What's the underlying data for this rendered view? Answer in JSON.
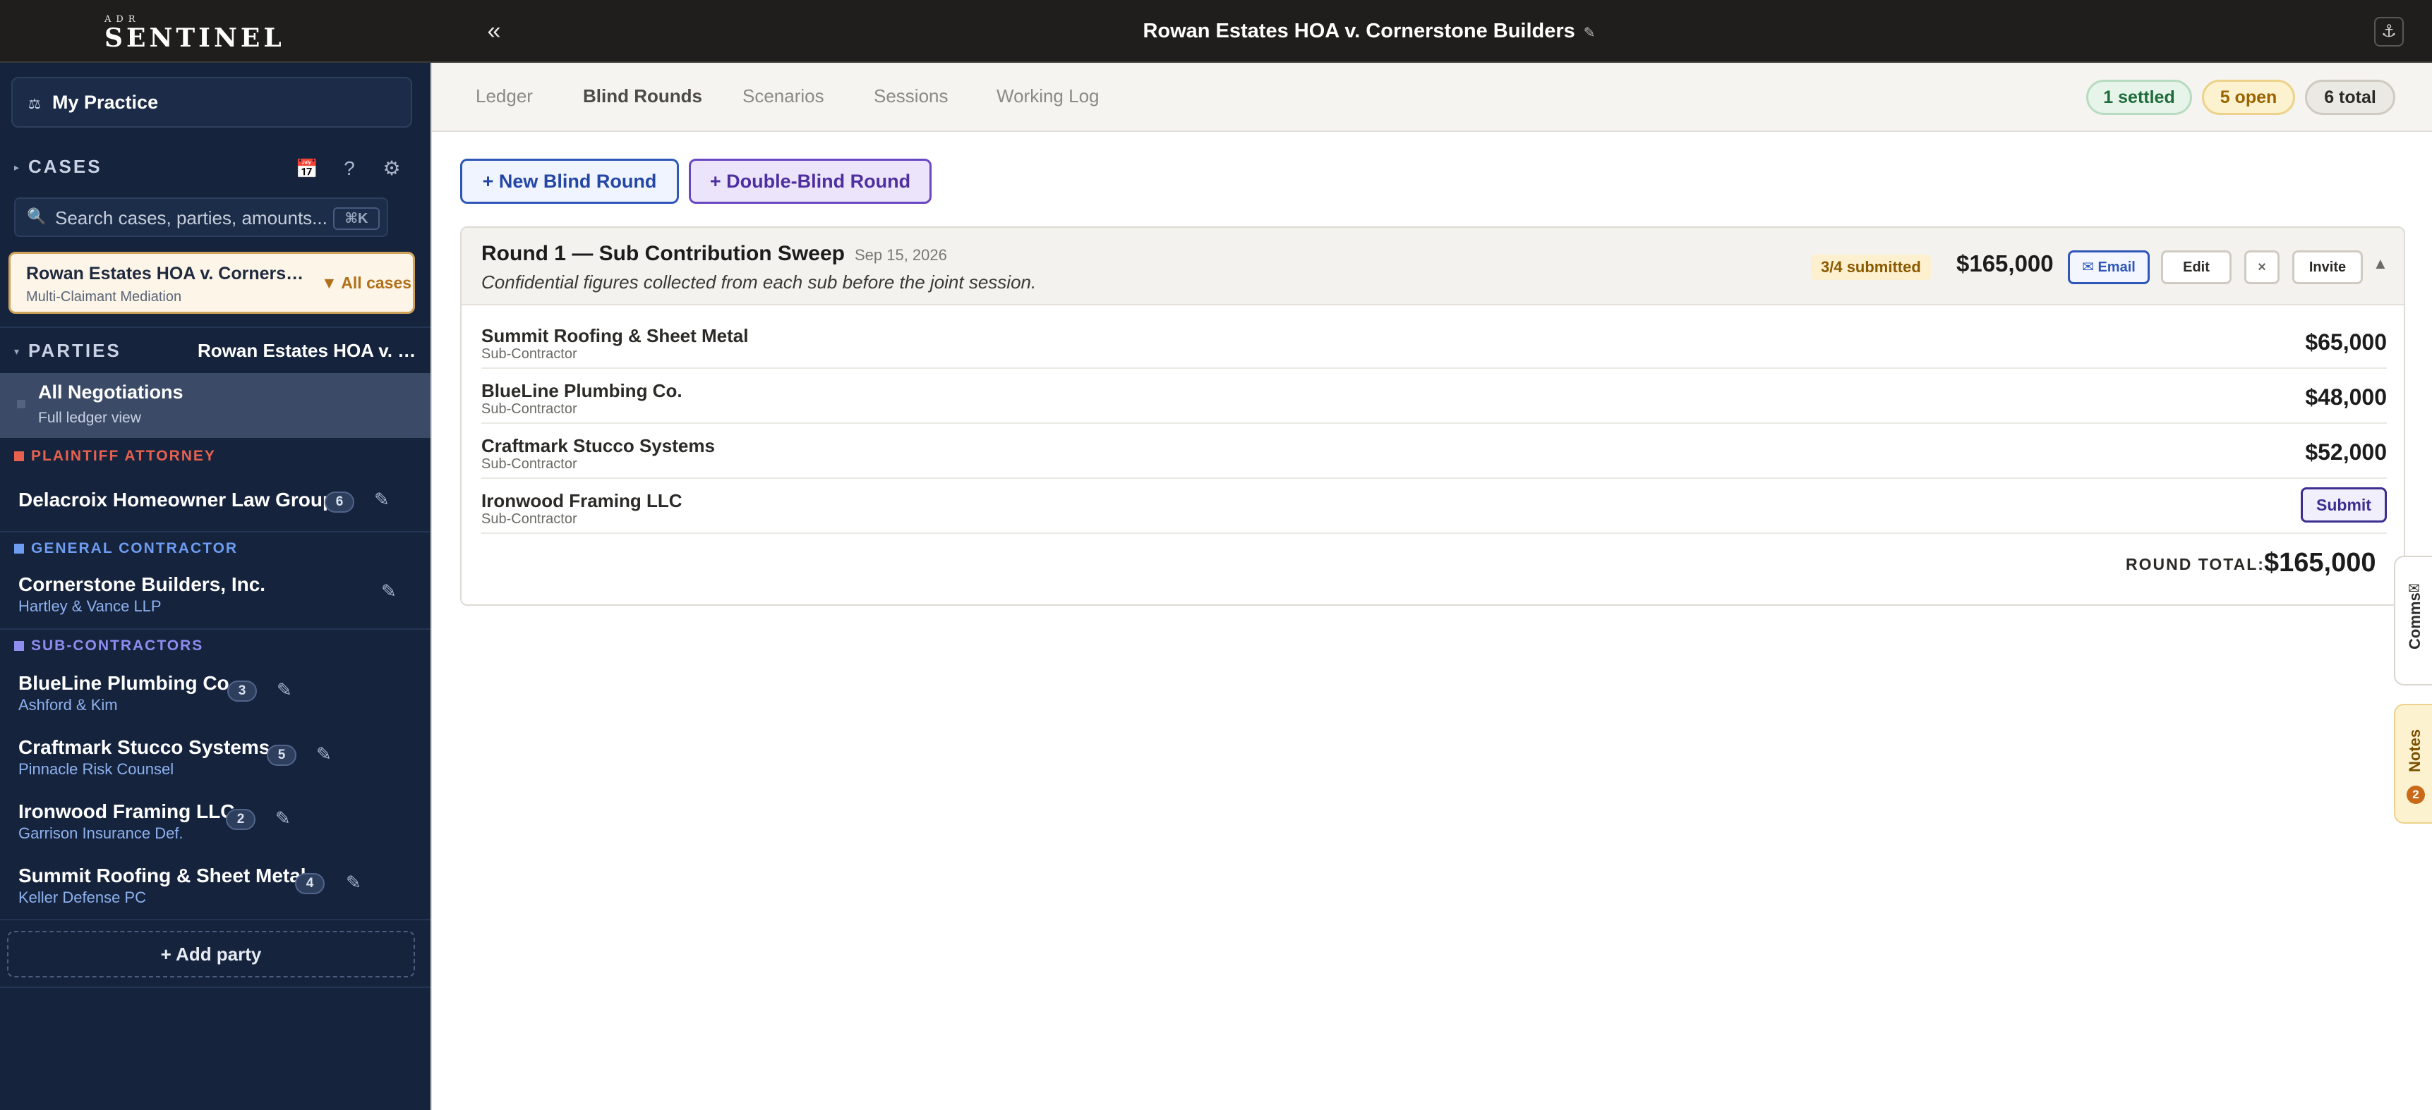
{
  "app": {
    "logo_sup": "ADR",
    "logo_main": "SENTINEL",
    "collapse_glyph": "«",
    "case_title": "Rowan Estates HOA v. Cornerstone Builders",
    "edit_glyph": "✎",
    "anchor_glyph": "⚓"
  },
  "sidebar": {
    "my_practice": "My Practice",
    "my_practice_icon": "⚖",
    "cases_label": "CASES",
    "calendar_icon": "📅",
    "help_icon": "?",
    "settings_icon": "⚙",
    "search_icon": "🔍",
    "search_placeholder": "Search cases, parties, amounts...",
    "search_shortcut": "⌘K",
    "active_case": {
      "name": "Rowan Estates HOA v. Cornerstone Builders",
      "type": "Multi-Claimant Mediation",
      "all_cases": "▼ All cases"
    },
    "parties_label": "PARTIES",
    "parties_case": "Rowan Estates HOA v. Cornerstone Builders",
    "all_negotiations": {
      "title": "All Negotiations",
      "sub": "Full ledger view"
    },
    "groups": {
      "plaintiff": {
        "label": "PLAINTIFF ATTORNEY",
        "color": "#e8614f"
      },
      "gc": {
        "label": "GENERAL CONTRACTOR",
        "color": "#6d9cf0"
      },
      "subs": {
        "label": "SUB-CONTRACTORS",
        "color": "#8f8cf0"
      }
    },
    "parties": [
      {
        "name": "Delacroix Homeowner Law Group",
        "counsel": "",
        "count": "6"
      },
      {
        "name": "Cornerstone Builders, Inc.",
        "counsel": "Hartley & Vance LLP",
        "count": ""
      },
      {
        "name": "BlueLine Plumbing Co.",
        "counsel": "Ashford & Kim",
        "count": "3"
      },
      {
        "name": "Craftmark Stucco Systems",
        "counsel": "Pinnacle Risk Counsel",
        "count": "5"
      },
      {
        "name": "Ironwood Framing LLC",
        "counsel": "Garrison Insurance Def.",
        "count": "2"
      },
      {
        "name": "Summit Roofing & Sheet Metal",
        "counsel": "Keller Defense PC",
        "count": "4"
      }
    ],
    "add_party": "+ Add party"
  },
  "tabs": [
    {
      "label": "Ledger"
    },
    {
      "label": "Blind Rounds",
      "active": true
    },
    {
      "label": "Scenarios"
    },
    {
      "label": "Sessions"
    },
    {
      "label": "Working Log"
    }
  ],
  "status_pills": {
    "settled": "1 settled",
    "open": "5 open",
    "total": "6 total"
  },
  "actions": {
    "new_blind": "+ New Blind Round",
    "double_blind": "+ Double-Blind Round"
  },
  "round": {
    "title": "Round 1 — Sub Contribution Sweep",
    "date": "Sep 15, 2026",
    "description": "Confidential figures collected from each sub before the joint session.",
    "submitted": "3/4 submitted",
    "amount": "$165,000",
    "email": "✉ Email",
    "edit": "Edit",
    "close": "×",
    "invite": "Invite",
    "collapse": "▲",
    "rows": [
      {
        "name": "Summit Roofing & Sheet Metal",
        "role": "Sub-Contractor",
        "amount": "$65,000"
      },
      {
        "name": "BlueLine Plumbing Co.",
        "role": "Sub-Contractor",
        "amount": "$48,000"
      },
      {
        "name": "Craftmark Stucco Systems",
        "role": "Sub-Contractor",
        "amount": "$52,000"
      },
      {
        "name": "Ironwood Framing LLC",
        "role": "Sub-Contractor",
        "amount": ""
      }
    ],
    "submit_label": "Submit",
    "total_label": "ROUND TOTAL:",
    "total": "$165,000"
  },
  "side_tabs": {
    "comms": "Comms",
    "comms_icon": "✉",
    "notes": "Notes",
    "notes_count": "2"
  },
  "colors": {
    "sidebar_bg": "#15233d",
    "topbar_bg": "#1f1e1c",
    "accent_blue": "#2f57b8",
    "accent_purple": "#6a47c2",
    "case_card_border": "#cfa35a"
  }
}
